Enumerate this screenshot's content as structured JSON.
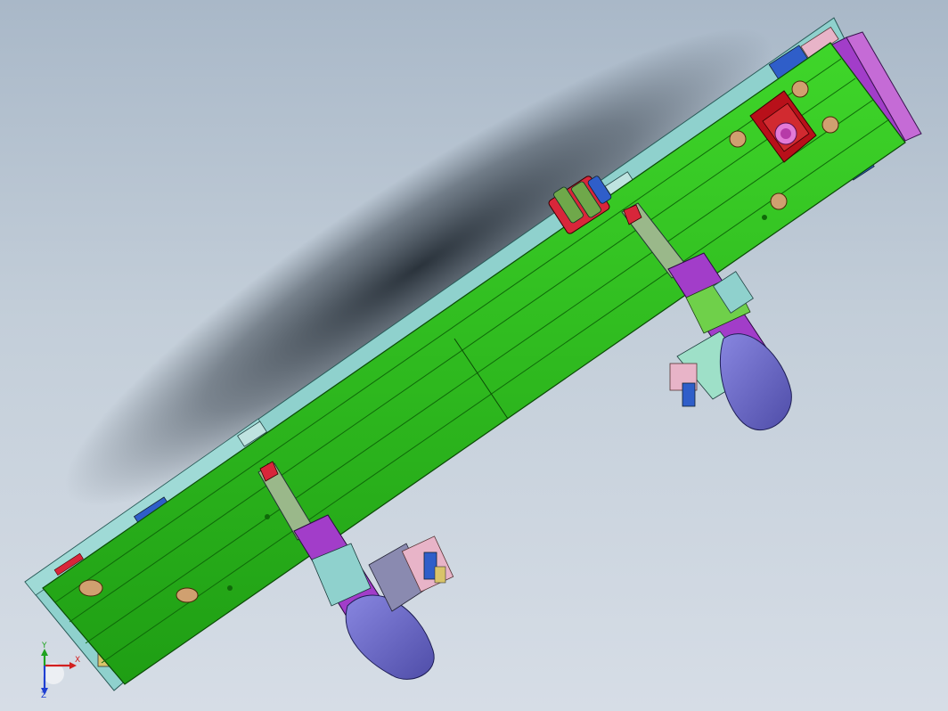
{
  "viewport": {
    "background_top": "#a9b8c8",
    "background_bottom": "#d6dde6"
  },
  "model": {
    "rail_color": "#27b81a",
    "rail_edge_color": "#0b4a06",
    "baseplate_color": "#8fd1cd",
    "bracket_color": "#a23dc9",
    "motor_color": "#6c6ac9",
    "mount_color": "#b8101a",
    "accent_colors": [
      "#d8263a",
      "#2f5ec9",
      "#e8b4c8",
      "#d9c46a",
      "#bfe3e0"
    ]
  },
  "triad": {
    "x_label": "X",
    "y_label": "Y",
    "z_label": "Z",
    "x_color": "#d21f1f",
    "y_color": "#1fa31f",
    "z_color": "#1f3fd2"
  }
}
